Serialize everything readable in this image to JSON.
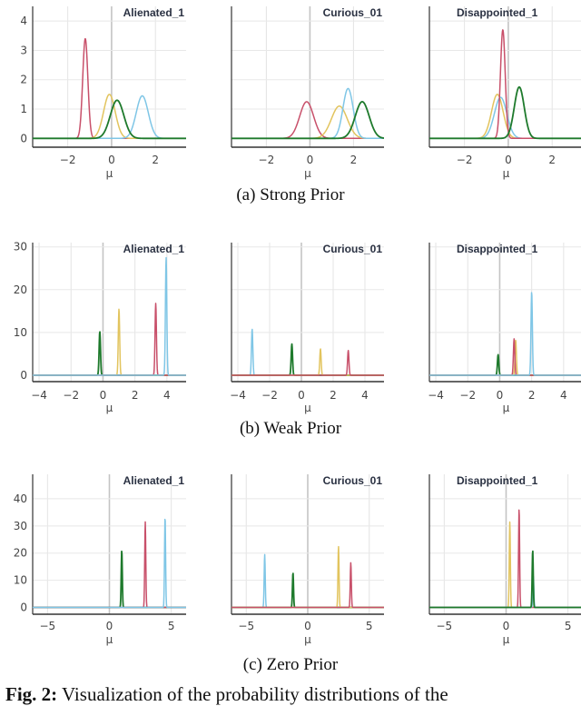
{
  "chart_data": [
    {
      "type": "line",
      "row": "Strong Prior",
      "caption": "(a) Strong Prior",
      "panels": [
        {
          "title": "Alienated_1",
          "xlabel": "μ",
          "xlim": [
            -3.6,
            3.4
          ],
          "ylim": [
            -0.3,
            4.5
          ],
          "xticks": [
            -2,
            0,
            2
          ],
          "yticks": [
            0,
            1,
            2,
            3,
            4
          ],
          "show_yticks": true,
          "series": [
            {
              "name": "red",
              "color": "#c8506a",
              "mean": -1.2,
              "peak": 3.4
            },
            {
              "name": "yellow",
              "color": "#e2c45e",
              "mean": -0.1,
              "peak": 1.5
            },
            {
              "name": "blue",
              "color": "#7fc6e6",
              "mean": 1.4,
              "peak": 1.45
            },
            {
              "name": "green",
              "color": "#1e7a2c",
              "mean": 0.25,
              "peak": 1.3
            }
          ]
        },
        {
          "title": "Curious_01",
          "xlabel": "μ",
          "xlim": [
            -3.6,
            3.4
          ],
          "ylim": [
            -0.3,
            4.5
          ],
          "xticks": [
            -2,
            0,
            2
          ],
          "yticks": [
            0,
            1,
            2,
            3,
            4
          ],
          "show_yticks": false,
          "series": [
            {
              "name": "red",
              "color": "#c8506a",
              "mean": -0.15,
              "peak": 1.25
            },
            {
              "name": "yellow",
              "color": "#e2c45e",
              "mean": 1.35,
              "peak": 1.1
            },
            {
              "name": "blue",
              "color": "#7fc6e6",
              "mean": 1.75,
              "peak": 1.7
            },
            {
              "name": "green",
              "color": "#1e7a2c",
              "mean": 2.4,
              "peak": 1.25
            }
          ]
        },
        {
          "title": "Disappointed_1",
          "xlabel": "μ",
          "xlim": [
            -3.6,
            3.4
          ],
          "ylim": [
            -0.3,
            4.5
          ],
          "xticks": [
            -2,
            0,
            2
          ],
          "yticks": [
            0,
            1,
            2,
            3,
            4
          ],
          "show_yticks": false,
          "series": [
            {
              "name": "yellow",
              "color": "#e2c45e",
              "mean": -0.5,
              "peak": 1.5
            },
            {
              "name": "blue",
              "color": "#7fc6e6",
              "mean": -0.35,
              "peak": 1.4
            },
            {
              "name": "red",
              "color": "#c8506a",
              "mean": -0.25,
              "peak": 3.7
            },
            {
              "name": "green",
              "color": "#1e7a2c",
              "mean": 0.5,
              "peak": 1.75
            }
          ]
        }
      ]
    },
    {
      "type": "line",
      "row": "Weak Prior",
      "caption": "(b) Weak Prior",
      "panels": [
        {
          "title": "Alienated_1",
          "xlabel": "μ",
          "xlim": [
            -4.4,
            5.2
          ],
          "ylim": [
            -1.5,
            31
          ],
          "xticks": [
            -4,
            -2,
            0,
            2,
            4
          ],
          "yticks": [
            0,
            10,
            20,
            30
          ],
          "show_yticks": true,
          "series": [
            {
              "name": "green",
              "color": "#1e7a2c",
              "mean": -0.2,
              "peak": 10.2
            },
            {
              "name": "yellow",
              "color": "#e2c45e",
              "mean": 1.0,
              "peak": 15.5
            },
            {
              "name": "red",
              "color": "#c8506a",
              "mean": 3.3,
              "peak": 16.8
            },
            {
              "name": "blue",
              "color": "#7fc6e6",
              "mean": 3.95,
              "peak": 27.5
            }
          ]
        },
        {
          "title": "Curious_01",
          "xlabel": "μ",
          "xlim": [
            -4.4,
            5.2
          ],
          "ylim": [
            -1.5,
            31
          ],
          "xticks": [
            -4,
            -2,
            0,
            2,
            4
          ],
          "yticks": [
            0,
            10,
            20,
            30
          ],
          "show_yticks": false,
          "series": [
            {
              "name": "blue",
              "color": "#7fc6e6",
              "mean": -3.1,
              "peak": 10.8
            },
            {
              "name": "green",
              "color": "#1e7a2c",
              "mean": -0.6,
              "peak": 7.3
            },
            {
              "name": "yellow",
              "color": "#e2c45e",
              "mean": 1.2,
              "peak": 6.2
            },
            {
              "name": "red",
              "color": "#c8506a",
              "mean": 2.95,
              "peak": 5.8
            }
          ]
        },
        {
          "title": "Disappointed_1",
          "xlabel": "μ",
          "xlim": [
            -4.4,
            5.2
          ],
          "ylim": [
            -1.5,
            31
          ],
          "xticks": [
            -4,
            -2,
            0,
            2,
            4
          ],
          "yticks": [
            0,
            10,
            20,
            30
          ],
          "show_yticks": false,
          "series": [
            {
              "name": "green",
              "color": "#1e7a2c",
              "mean": -0.1,
              "peak": 4.8
            },
            {
              "name": "yellow",
              "color": "#e2c45e",
              "mean": 1.0,
              "peak": 8.2
            },
            {
              "name": "red",
              "color": "#c8506a",
              "mean": 0.9,
              "peak": 8.5
            },
            {
              "name": "blue",
              "color": "#7fc6e6",
              "mean": 2.0,
              "peak": 19.5
            }
          ]
        }
      ]
    },
    {
      "type": "line",
      "row": "Zero Prior",
      "caption": "(c) Zero Prior",
      "panels": [
        {
          "title": "Alienated_1",
          "xlabel": "μ",
          "xlim": [
            -6.2,
            6.2
          ],
          "ylim": [
            -2.5,
            49
          ],
          "xticks": [
            -5,
            0,
            5
          ],
          "yticks": [
            0,
            10,
            20,
            30,
            40
          ],
          "show_yticks": true,
          "series": [
            {
              "name": "green",
              "color": "#1e7a2c",
              "mean": 1.0,
              "peak": 21
            },
            {
              "name": "red",
              "color": "#c8506a",
              "mean": 2.9,
              "peak": 31.5
            },
            {
              "name": "blue",
              "color": "#7fc6e6",
              "mean": 4.5,
              "peak": 33.5
            }
          ]
        },
        {
          "title": "Curious_01",
          "xlabel": "μ",
          "xlim": [
            -6.2,
            6.2
          ],
          "ylim": [
            -2.5,
            49
          ],
          "xticks": [
            -5,
            0,
            5
          ],
          "yticks": [
            0,
            10,
            20,
            30,
            40
          ],
          "show_yticks": false,
          "series": [
            {
              "name": "blue",
              "color": "#7fc6e6",
              "mean": -3.5,
              "peak": 19.5
            },
            {
              "name": "green",
              "color": "#1e7a2c",
              "mean": -1.2,
              "peak": 12.8
            },
            {
              "name": "yellow",
              "color": "#e2c45e",
              "mean": 2.5,
              "peak": 22.5
            },
            {
              "name": "red",
              "color": "#c8506a",
              "mean": 3.5,
              "peak": 16.5
            }
          ]
        },
        {
          "title": "Disappointed_1",
          "xlabel": "μ",
          "xlim": [
            -6.2,
            6.2
          ],
          "ylim": [
            -2.5,
            49
          ],
          "xticks": [
            -5,
            0,
            5
          ],
          "yticks": [
            0,
            10,
            20,
            30,
            40
          ],
          "show_yticks": false,
          "series": [
            {
              "name": "yellow",
              "color": "#e2c45e",
              "mean": 0.3,
              "peak": 31.5
            },
            {
              "name": "red",
              "color": "#c8506a",
              "mean": 1.05,
              "peak": 36.5
            },
            {
              "name": "blue",
              "color": "#7fc6e6",
              "mean": 2.2,
              "peak": 11.5
            },
            {
              "name": "green",
              "color": "#1e7a2c",
              "mean": 2.15,
              "peak": 21
            }
          ]
        }
      ]
    }
  ],
  "figure_caption": {
    "label": "Fig. 2:",
    "text": " Visualization of the probability distributions of the"
  }
}
